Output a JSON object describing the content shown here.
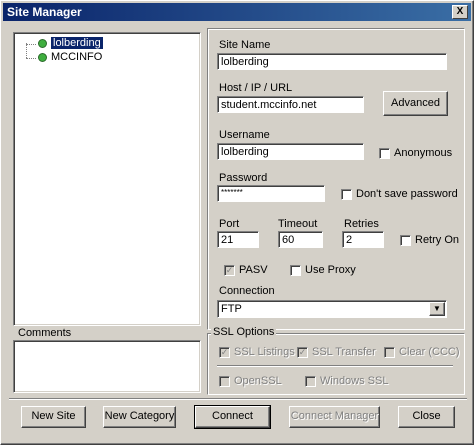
{
  "window": {
    "title": "Site Manager",
    "close_glyph": "X"
  },
  "tree": {
    "items": [
      {
        "label": "lolberding",
        "selected": true
      },
      {
        "label": "MCCINFO",
        "selected": false
      }
    ]
  },
  "comments": {
    "label": "Comments"
  },
  "form": {
    "site_name": {
      "label": "Site Name",
      "value": "lolberding"
    },
    "host": {
      "label": "Host / IP / URL",
      "value": "student.mccinfo.net"
    },
    "advanced_button": "Advanced",
    "username": {
      "label": "Username",
      "value": "lolberding"
    },
    "anonymous": {
      "label": "Anonymous",
      "checked": false
    },
    "password": {
      "label": "Password",
      "value": "*******"
    },
    "dont_save_password": {
      "label": "Don't save password",
      "checked": false
    },
    "port": {
      "label": "Port",
      "value": "21"
    },
    "timeout": {
      "label": "Timeout",
      "value": "60"
    },
    "retries": {
      "label": "Retries",
      "value": "2"
    },
    "retry_on": {
      "label": "Retry On",
      "checked": false
    },
    "pasv": {
      "label": "PASV",
      "checked": true
    },
    "use_proxy": {
      "label": "Use Proxy",
      "checked": false
    },
    "connection": {
      "label": "Connection",
      "value": "FTP"
    }
  },
  "ssl": {
    "label": "SSL Options",
    "ssl_listings": {
      "label": "SSL Listings",
      "checked": true
    },
    "ssl_transfer": {
      "label": "SSL Transfer",
      "checked": true
    },
    "clear_ccc": {
      "label": "Clear (CCC)",
      "checked": false
    },
    "openssl": {
      "label": "OpenSSL",
      "checked": false
    },
    "windows_ssl": {
      "label": "Windows SSL",
      "checked": false
    }
  },
  "buttons": {
    "new_site": "New Site",
    "new_category": "New Category",
    "connect": "Connect",
    "connect_manager": "Connect Manager",
    "close": "Close"
  },
  "colors": {
    "titlebar": "#0a246a",
    "face": "#d4d0c8",
    "node": "#3fae3f"
  }
}
